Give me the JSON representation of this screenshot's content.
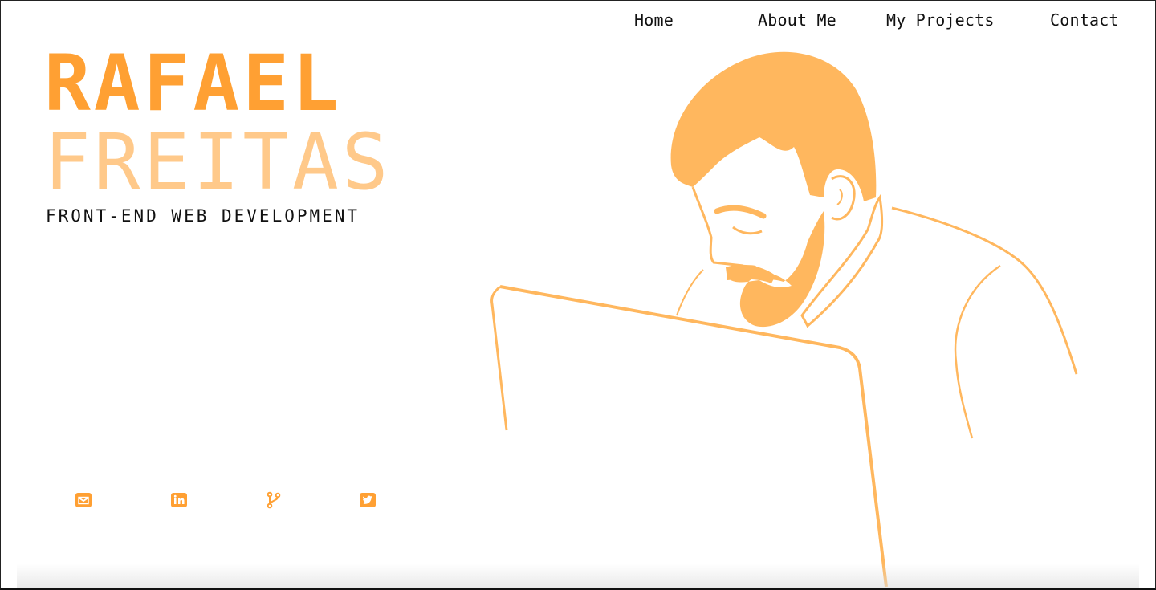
{
  "nav": {
    "items": [
      {
        "label": "Home"
      },
      {
        "label": "About Me"
      },
      {
        "label": "My Projects"
      },
      {
        "label": "Contact"
      }
    ]
  },
  "hero": {
    "first_name": "RAFAEL",
    "last_name": "FREITAS",
    "tagline": "FRONT-END WEB DEVELOPMENT"
  },
  "social": [
    {
      "icon": "envelope-icon"
    },
    {
      "icon": "linkedin-icon"
    },
    {
      "icon": "git-branch-icon"
    },
    {
      "icon": "twitter-icon"
    }
  ],
  "colors": {
    "accent": "#ffa033",
    "accent_light": "#ffc98a",
    "illustration": "#ffb75e",
    "text": "#111111",
    "background": "#ffffff"
  }
}
